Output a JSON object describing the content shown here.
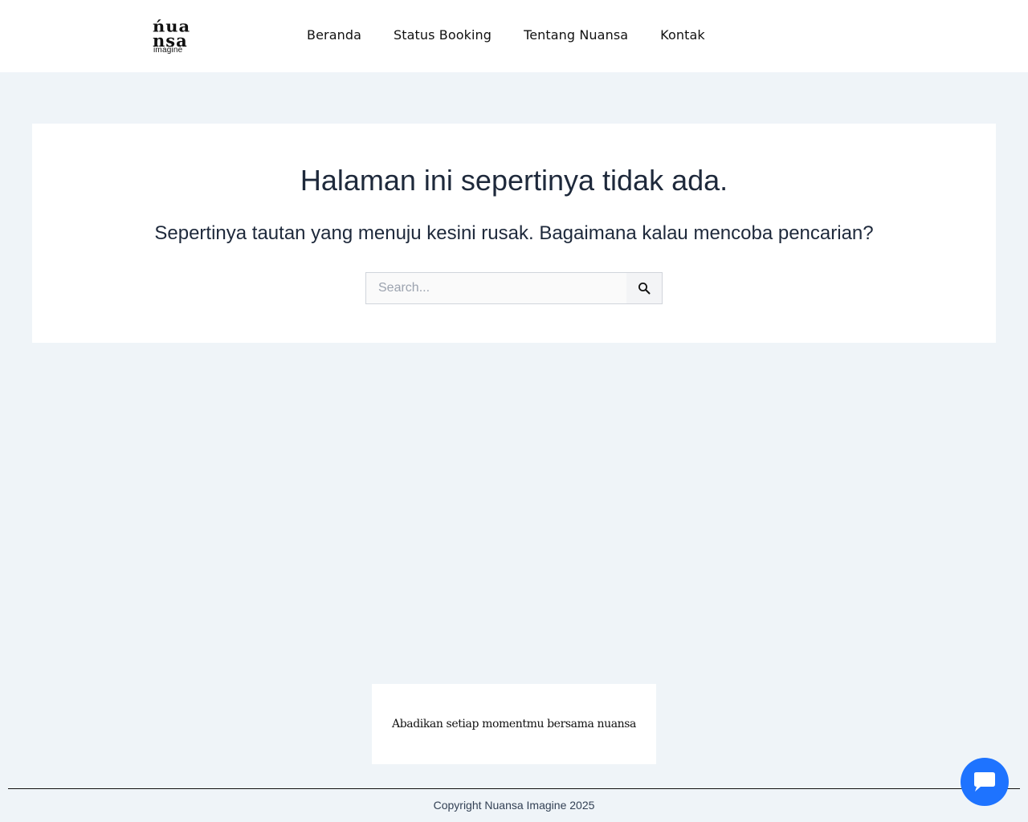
{
  "header": {
    "logo": {
      "line1": "ńua",
      "line2": "nsa",
      "line3": "imagine"
    },
    "nav": [
      {
        "label": "Beranda"
      },
      {
        "label": "Status Booking"
      },
      {
        "label": "Tentang Nuansa"
      },
      {
        "label": "Kontak"
      }
    ]
  },
  "main": {
    "title": "Halaman ini sepertinya tidak ada.",
    "subtitle": "Sepertinya tautan yang menuju kesini rusak. Bagaimana kalau mencoba pencarian?",
    "search": {
      "placeholder": "Search...",
      "value": ""
    }
  },
  "footer": {
    "tagline": "Abadikan setiap momentmu bersama nuansa",
    "copyright": "Copyright Nuansa Imagine 2025"
  },
  "icons": {
    "search": "search-icon",
    "chat": "chat-icon"
  },
  "colors": {
    "background": "#eff4f8",
    "card": "#ffffff",
    "text": "#1e293b",
    "chat_button": "#1e73ff"
  }
}
